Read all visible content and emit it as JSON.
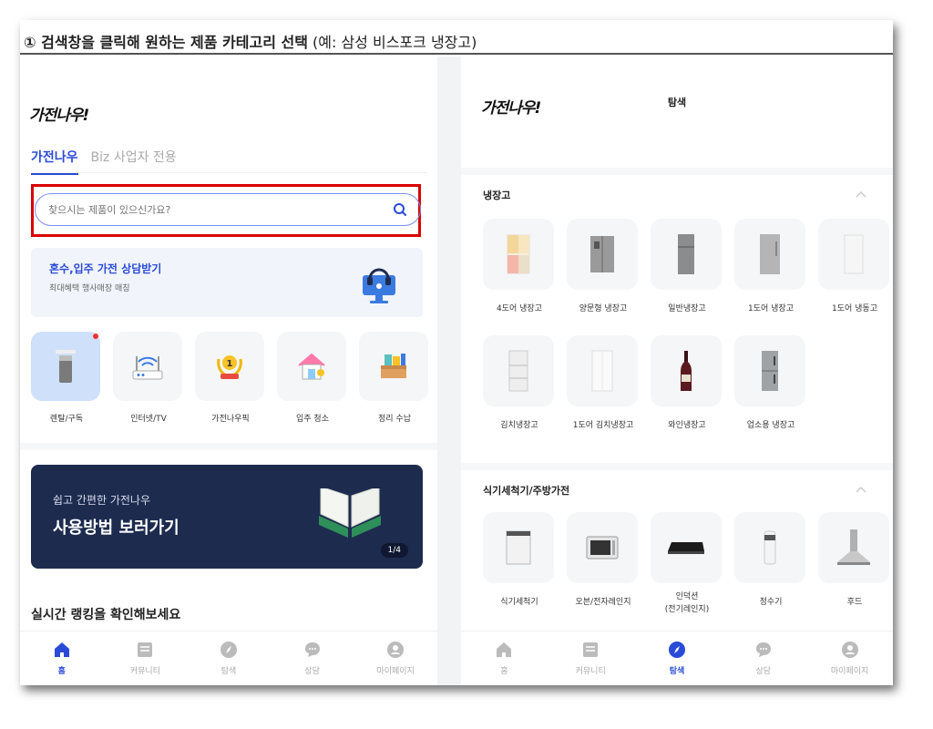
{
  "caption": {
    "step": "① 검색창을 클릭해 원하는 제품 카테고리 선택",
    "example": " (예: 삼성 비스포크 냉장고)"
  },
  "left": {
    "logo": "가전나우!",
    "tabs": [
      "가전나우",
      "Biz 사업자 전용"
    ],
    "search": {
      "placeholder": "찾으시는 제품이 있으신가요?"
    },
    "consult": {
      "title": "혼수,입주 가전 상담받기",
      "subtitle": "최대혜택 행사매장 매칭"
    },
    "quick_items": [
      {
        "label": "렌탈/구독",
        "icon": "air-purifier-icon"
      },
      {
        "label": "인터넷/TV",
        "icon": "router-icon"
      },
      {
        "label": "가전나우픽",
        "icon": "medal-icon"
      },
      {
        "label": "입주 청소",
        "icon": "house-icon"
      },
      {
        "label": "정리 수납",
        "icon": "storage-box-icon"
      }
    ],
    "banner": {
      "subtitle": "쉽고 간편한 가전나우",
      "title": "사용방법 보러가기",
      "page": "1/4"
    },
    "ranking_title": "실시간 랭킹을 확인해보세요",
    "nav": [
      {
        "label": "홈",
        "icon": "home-icon",
        "active": true
      },
      {
        "label": "커뮤니티",
        "icon": "community-icon",
        "active": false
      },
      {
        "label": "탐색",
        "icon": "compass-icon",
        "active": false
      },
      {
        "label": "상담",
        "icon": "chat-icon",
        "active": false
      },
      {
        "label": "마이페이지",
        "icon": "user-icon",
        "active": false
      }
    ]
  },
  "right": {
    "logo": "가전나우!",
    "title": "탐색",
    "sections": [
      {
        "title": "냉장고",
        "items": [
          "4도어 냉장고",
          "양문형 냉장고",
          "일반냉장고",
          "1도어 냉장고",
          "1도어 냉동고",
          "김치냉장고",
          "1도어 김치냉장고",
          "와인냉장고",
          "업소용 냉장고"
        ]
      },
      {
        "title": "식기세척기/주방가전",
        "items": [
          "식기세척기",
          "오븐/전자레인지",
          "인덕션\n(전기레인지)",
          "정수기",
          "후드"
        ]
      }
    ],
    "nav": [
      {
        "label": "홈",
        "icon": "home-icon",
        "active": false
      },
      {
        "label": "커뮤니티",
        "icon": "community-icon",
        "active": false
      },
      {
        "label": "탐색",
        "icon": "compass-icon",
        "active": true
      },
      {
        "label": "상담",
        "icon": "chat-icon",
        "active": false
      },
      {
        "label": "마이페이지",
        "icon": "user-icon",
        "active": false
      }
    ]
  },
  "colors": {
    "accent": "#2a4bd7",
    "highlight": "#d90000",
    "banner_bg": "#1d2b4f"
  }
}
